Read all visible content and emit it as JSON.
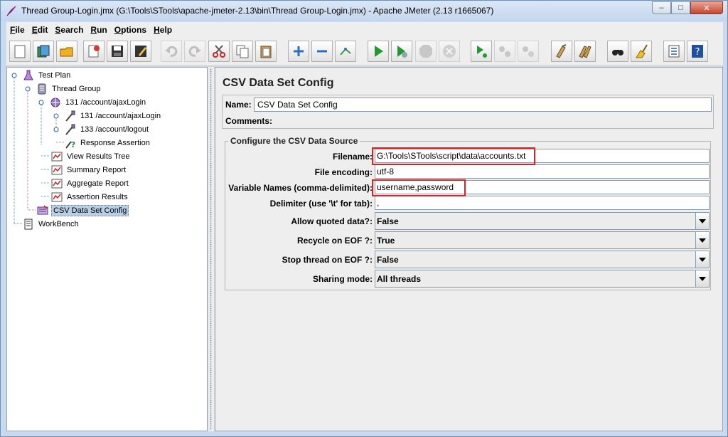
{
  "window": {
    "title": "Thread Group-Login.jmx (G:\\Tools\\STools\\apache-jmeter-2.13\\bin\\Thread Group-Login.jmx) - Apache JMeter (2.13 r1665067)",
    "controls": {
      "minimize": "–",
      "maximize": "□",
      "close": "✕"
    }
  },
  "menubar": {
    "items": [
      {
        "label": "File",
        "mnemonic": "F",
        "rest": "ile"
      },
      {
        "label": "Edit",
        "mnemonic": "E",
        "rest": "dit"
      },
      {
        "label": "Search",
        "mnemonic": "S",
        "rest": "earch"
      },
      {
        "label": "Run",
        "mnemonic": "R",
        "rest": "un"
      },
      {
        "label": "Options",
        "mnemonic": "O",
        "rest": "ptions"
      },
      {
        "label": "Help",
        "mnemonic": "H",
        "rest": "elp"
      }
    ]
  },
  "toolbar": {
    "buttons": [
      "new-icon",
      "templates-icon",
      "open-icon",
      "close-file-icon",
      "save-icon",
      "save-as-icon",
      "undo-icon",
      "redo-icon",
      "cut-icon",
      "copy-icon",
      "paste-icon",
      "expand-icon",
      "collapse-icon",
      "toggle-icon",
      "start-icon",
      "start-no-pause-icon",
      "stop-icon",
      "shutdown-icon",
      "remote-start-icon",
      "remote-stop-icon",
      "remote-shutdown-icon",
      "clear-icon",
      "clear-all-icon",
      "search-icon",
      "reset-search-icon",
      "function-helper-icon",
      "help-icon"
    ]
  },
  "tree": {
    "items": [
      {
        "label": "Test Plan",
        "icon": "test-plan-icon"
      },
      {
        "label": "Thread Group",
        "icon": "thread-group-icon"
      },
      {
        "label": "131 /account/ajaxLogin",
        "icon": "transaction-controller-icon"
      },
      {
        "label": "131 /account/ajaxLogin",
        "icon": "http-sampler-icon"
      },
      {
        "label": "133 /account/logout",
        "icon": "http-sampler-icon"
      },
      {
        "label": "Response Assertion",
        "icon": "assertion-icon"
      },
      {
        "label": "View Results Tree",
        "icon": "listener-icon"
      },
      {
        "label": "Summary Report",
        "icon": "listener-icon"
      },
      {
        "label": "Aggregate Report",
        "icon": "listener-icon"
      },
      {
        "label": "Assertion Results",
        "icon": "listener-icon"
      },
      {
        "label": "CSV Data Set Config",
        "icon": "csv-config-icon",
        "selected": true
      },
      {
        "label": "WorkBench",
        "icon": "workbench-icon"
      }
    ]
  },
  "panel": {
    "title": "CSV Data Set Config",
    "name_label": "Name:",
    "name_value": "CSV Data Set Config",
    "comments_label": "Comments:",
    "comments_value": "",
    "group_title": "Configure the CSV Data Source",
    "fields": [
      {
        "label": "Filename:",
        "value": "G:\\Tools\\STools\\script\\data\\accounts.txt",
        "highlighted": true
      },
      {
        "label": "File encoding:",
        "value": "utf-8"
      },
      {
        "label": "Variable Names (comma-delimited):",
        "value": "username,password",
        "highlighted": true
      },
      {
        "label": "Delimiter (use '\\t' for tab):",
        "value": ","
      }
    ],
    "selects": [
      {
        "label": "Allow quoted data?:",
        "value": "False"
      },
      {
        "label": "Recycle on EOF ?:",
        "value": "True"
      },
      {
        "label": "Stop thread on EOF ?:",
        "value": "False"
      },
      {
        "label": "Sharing mode:",
        "value": "All threads"
      }
    ]
  },
  "colors": {
    "highlight_box": "#e02020",
    "selection": "#b8cfe5"
  }
}
